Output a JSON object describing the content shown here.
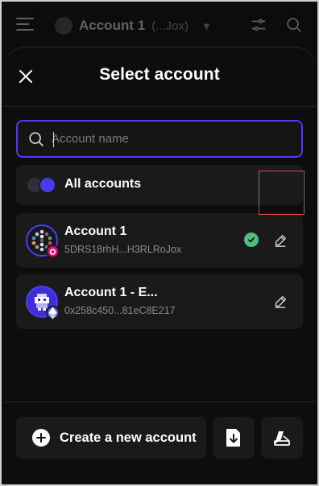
{
  "app_header": {
    "account_name": "Account 1",
    "account_short_address": "(...Jox)"
  },
  "modal": {
    "title": "Select account",
    "search": {
      "placeholder": "Account name",
      "value": ""
    }
  },
  "accounts": {
    "all_label": "All accounts",
    "items": [
      {
        "name": "Account 1",
        "address": "5DRS18rhH...H3RLRoJox",
        "network": "polkadot",
        "selected": true
      },
      {
        "name": "Account 1 - E...",
        "address": "0x258c450...81eC8E217",
        "network": "ethereum",
        "selected": false
      }
    ]
  },
  "footer": {
    "create_label": "Create a new account"
  },
  "colors": {
    "accent": "#4d3df0",
    "selected_check": "#4ebe7d",
    "highlight": "#e0483a",
    "polkadot_badge": "#e6007a"
  },
  "icons": [
    "menu-icon",
    "settings-sliders-icon",
    "search-icon",
    "close-icon",
    "check-icon",
    "edit-pencil-icon",
    "plus-icon",
    "import-file-icon",
    "ledger-icon"
  ]
}
